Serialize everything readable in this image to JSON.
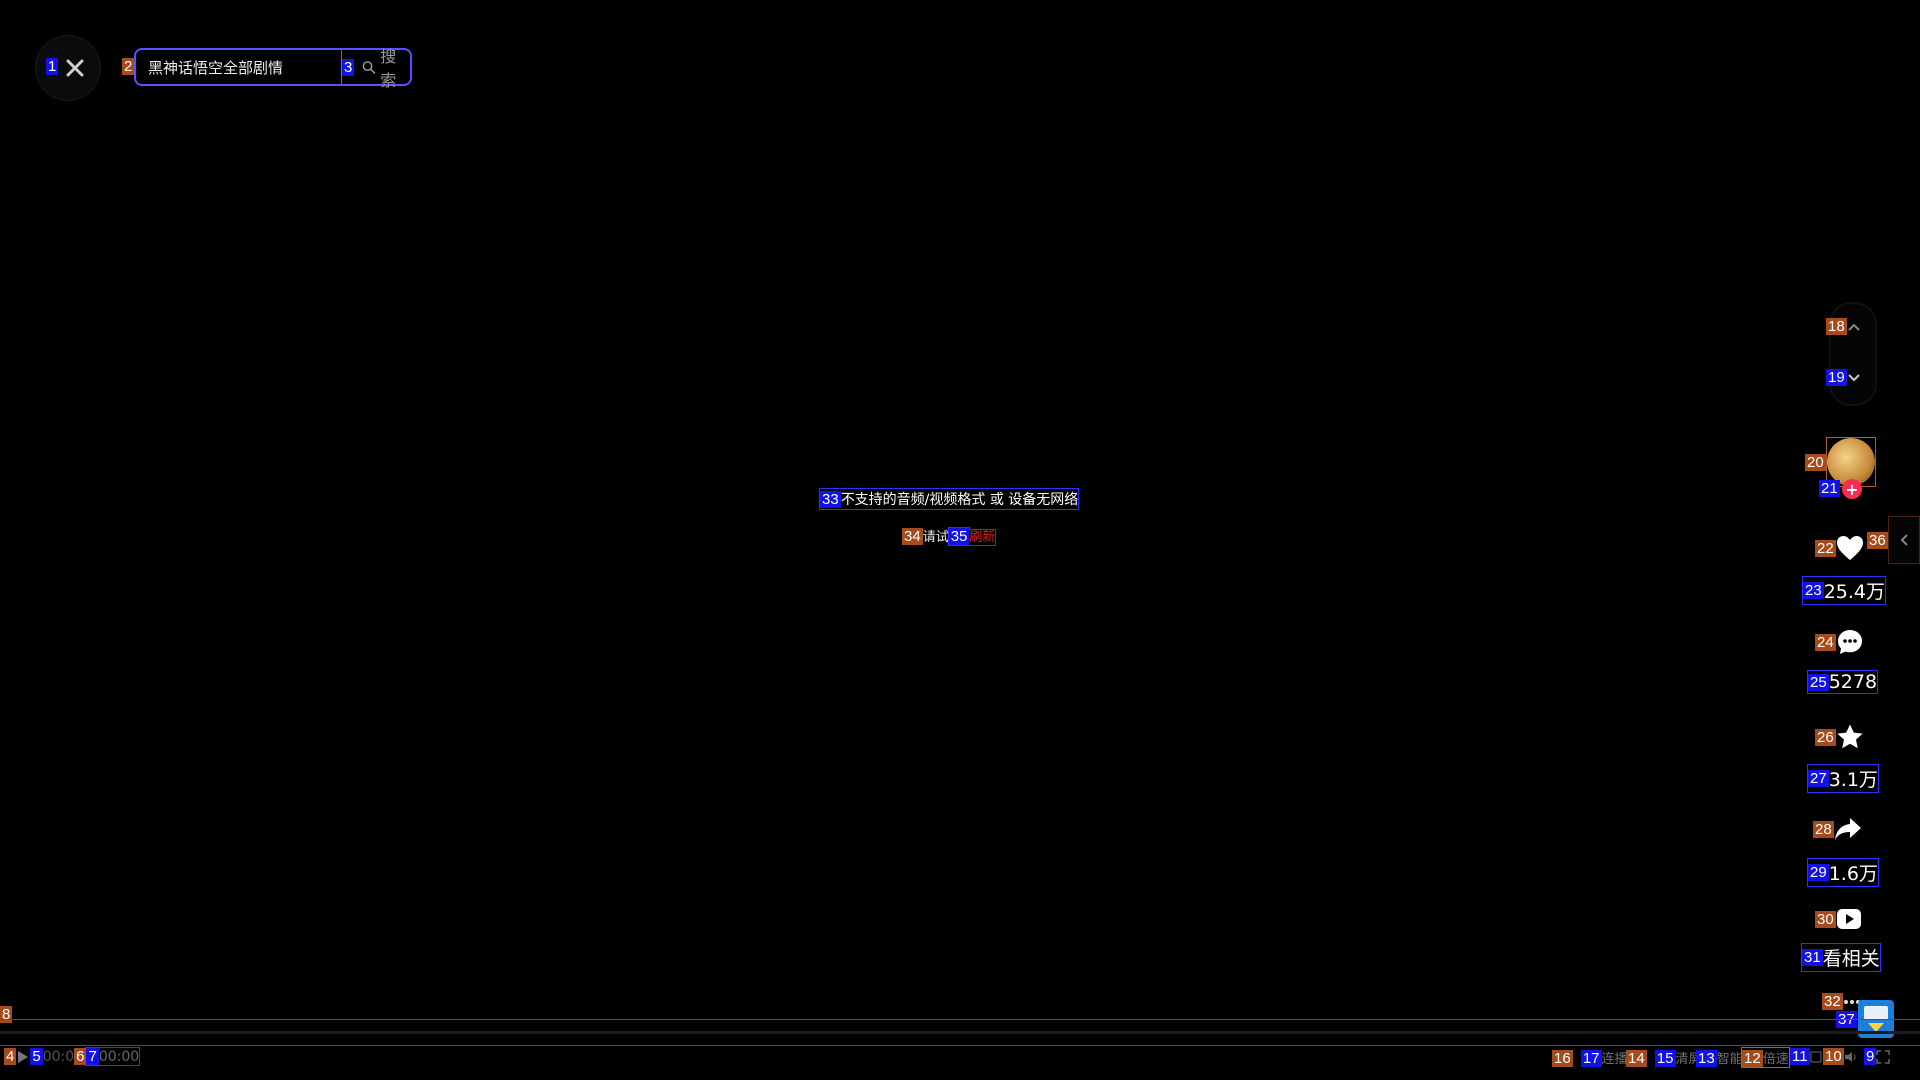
{
  "search": {
    "value": "黑神话悟空全部剧情",
    "button_label": "搜索"
  },
  "player": {
    "error_message": "不支持的音频/视频格式 或 设备无网络",
    "retry_prefix": "请试",
    "retry_link": "刷新",
    "time_current": "00:0",
    "time_total": "00:00"
  },
  "actions": {
    "likes": "25.4万",
    "comments": "5278",
    "favorites": "3.1万",
    "shares": "1.6万",
    "related_label": "看相关"
  },
  "controls": {
    "autoplay": "连播",
    "clear_screen": "清屏",
    "smart": "智能",
    "speed": "倍速"
  },
  "badges": [
    "1",
    "2",
    "3",
    "4",
    "5",
    "6",
    "7",
    "8",
    "9",
    "10",
    "11",
    "12",
    "13",
    "14",
    "15",
    "16",
    "17",
    "18",
    "19",
    "20",
    "21",
    "22",
    "23",
    "24",
    "25",
    "26",
    "27",
    "28",
    "29",
    "30",
    "31",
    "32",
    "33",
    "34",
    "35",
    "36",
    "37"
  ],
  "colors": {
    "accent_red": "#e02020",
    "search_border": "#5b4eff"
  }
}
